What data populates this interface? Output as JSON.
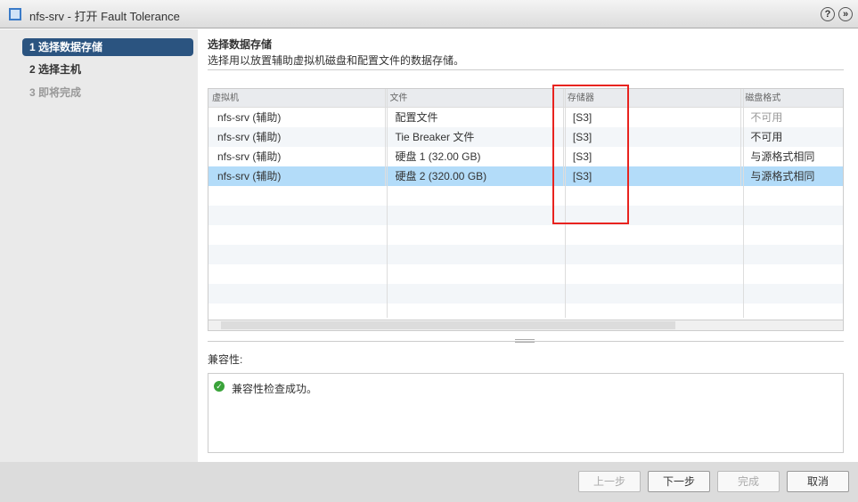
{
  "window": {
    "title": "nfs-srv - 打开 Fault Tolerance",
    "help": "?",
    "expand": "»"
  },
  "steps": [
    {
      "label": "1  选择数据存储"
    },
    {
      "label": "2  选择主机"
    },
    {
      "label": "3  即将完成"
    }
  ],
  "main": {
    "title": "选择数据存储",
    "subtitle": "选择用以放置辅助虚拟机磁盘和配置文件的数据存储。"
  },
  "table": {
    "columns": [
      "虚拟机",
      "文件",
      "存储器",
      "磁盘格式"
    ],
    "rows": [
      [
        "nfs-srv (辅助)",
        "配置文件",
        "[S3]",
        "不可用"
      ],
      [
        "nfs-srv (辅助)",
        "Tie Breaker 文件",
        "[S3]",
        "不可用"
      ],
      [
        "nfs-srv (辅助)",
        "硬盘 1 (32.00 GB)",
        "[S3]",
        "与源格式相同"
      ],
      [
        "nfs-srv (辅助)",
        "硬盘 2 (320.00 GB)",
        "[S3]",
        "与源格式相同"
      ]
    ]
  },
  "compat": {
    "label": "兼容性:",
    "message": "兼容性检查成功。"
  },
  "footer": {
    "back": "上一步",
    "next": "下一步",
    "finish": "完成",
    "cancel": "取消"
  }
}
